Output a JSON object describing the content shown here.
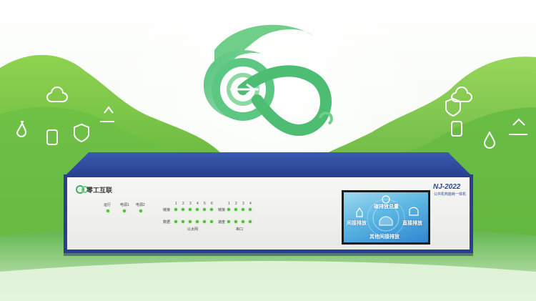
{
  "device": {
    "brand_name": "零工互联",
    "model": "NJ-2022",
    "model_subtitle": "公共机构能耗一体机",
    "status_labels": [
      "运行",
      "电源1",
      "电源2"
    ],
    "port_numbers_left": [
      "1",
      "2",
      "3",
      "4",
      "5",
      "6"
    ],
    "port_numbers_right": [
      "1",
      "2",
      "3",
      "4"
    ],
    "row_label_link": "链接",
    "row_label_data": "数据",
    "row_label_link2": "链接",
    "row_label_data2": "速度",
    "group_label_switch": "以太网",
    "group_label_serial": "串口"
  },
  "screen": {
    "title": "碳排放总量",
    "left_label": "间接排放",
    "right_label": "直接排放",
    "bottom_label": "其他间接排放"
  },
  "colors": {
    "brand_green": "#3fb35a",
    "device_blue": "#2a3f8f",
    "led_green": "#4fbf3a"
  }
}
